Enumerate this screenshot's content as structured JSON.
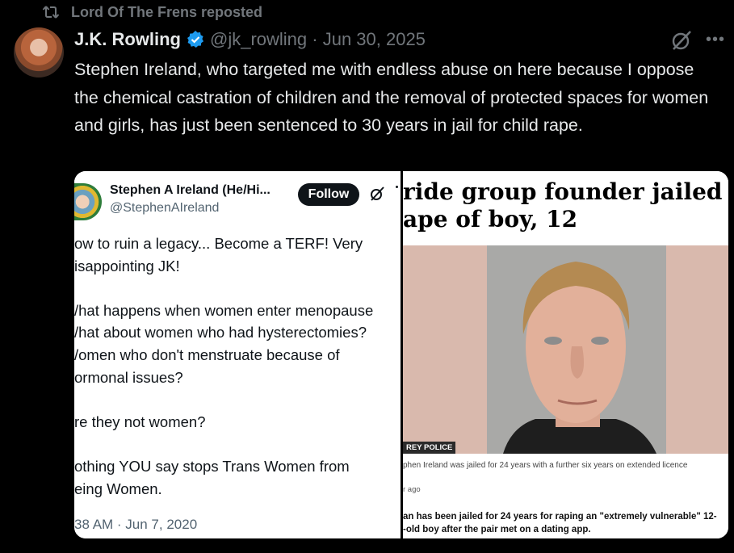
{
  "repost": {
    "icon": "repost-icon",
    "text": "Lord Of The Frens reposted"
  },
  "tweet": {
    "author_name": "J.K. Rowling",
    "handle_time": "@jk_rowling · Jun 30, 2025",
    "text": "Stephen Ireland, who targeted me with endless abuse on here because I oppose the chemical castration of children and the removal of protected spaces for women and girls, has just been sentenced to 30 years in jail for child rape.",
    "verified_color": "#1d9bf0"
  },
  "embedded_tweet": {
    "name": "Stephen A Ireland (He/Hi...",
    "handle": "@StephenAIreland",
    "follow_label": "Follow",
    "lines": [
      "ow to ruin a legacy... Become a TERF! Very",
      "isappointing JK!",
      "",
      "/hat happens when women enter menopause",
      "/hat about women who had hysterectomies?",
      "/omen who don't menstruate because of",
      "ormonal issues?",
      "",
      "re they not women?",
      "",
      "othing YOU say stops Trans Women from",
      "eing Women."
    ],
    "time": "38 AM · Jun 7, 2020"
  },
  "news": {
    "headline_lines": [
      "ride group founder jailed fo",
      "ape of boy, 12"
    ],
    "photo_credit": "REY POLICE",
    "caption": "phen Ireland was jailed for 24 years with a further six years on extended licence",
    "ago": "r ago",
    "story_lines": [
      "an has been jailed for 24 years for raping an \"extremely vulnerable\" 12-",
      "-old boy after the pair met on a dating app."
    ]
  }
}
